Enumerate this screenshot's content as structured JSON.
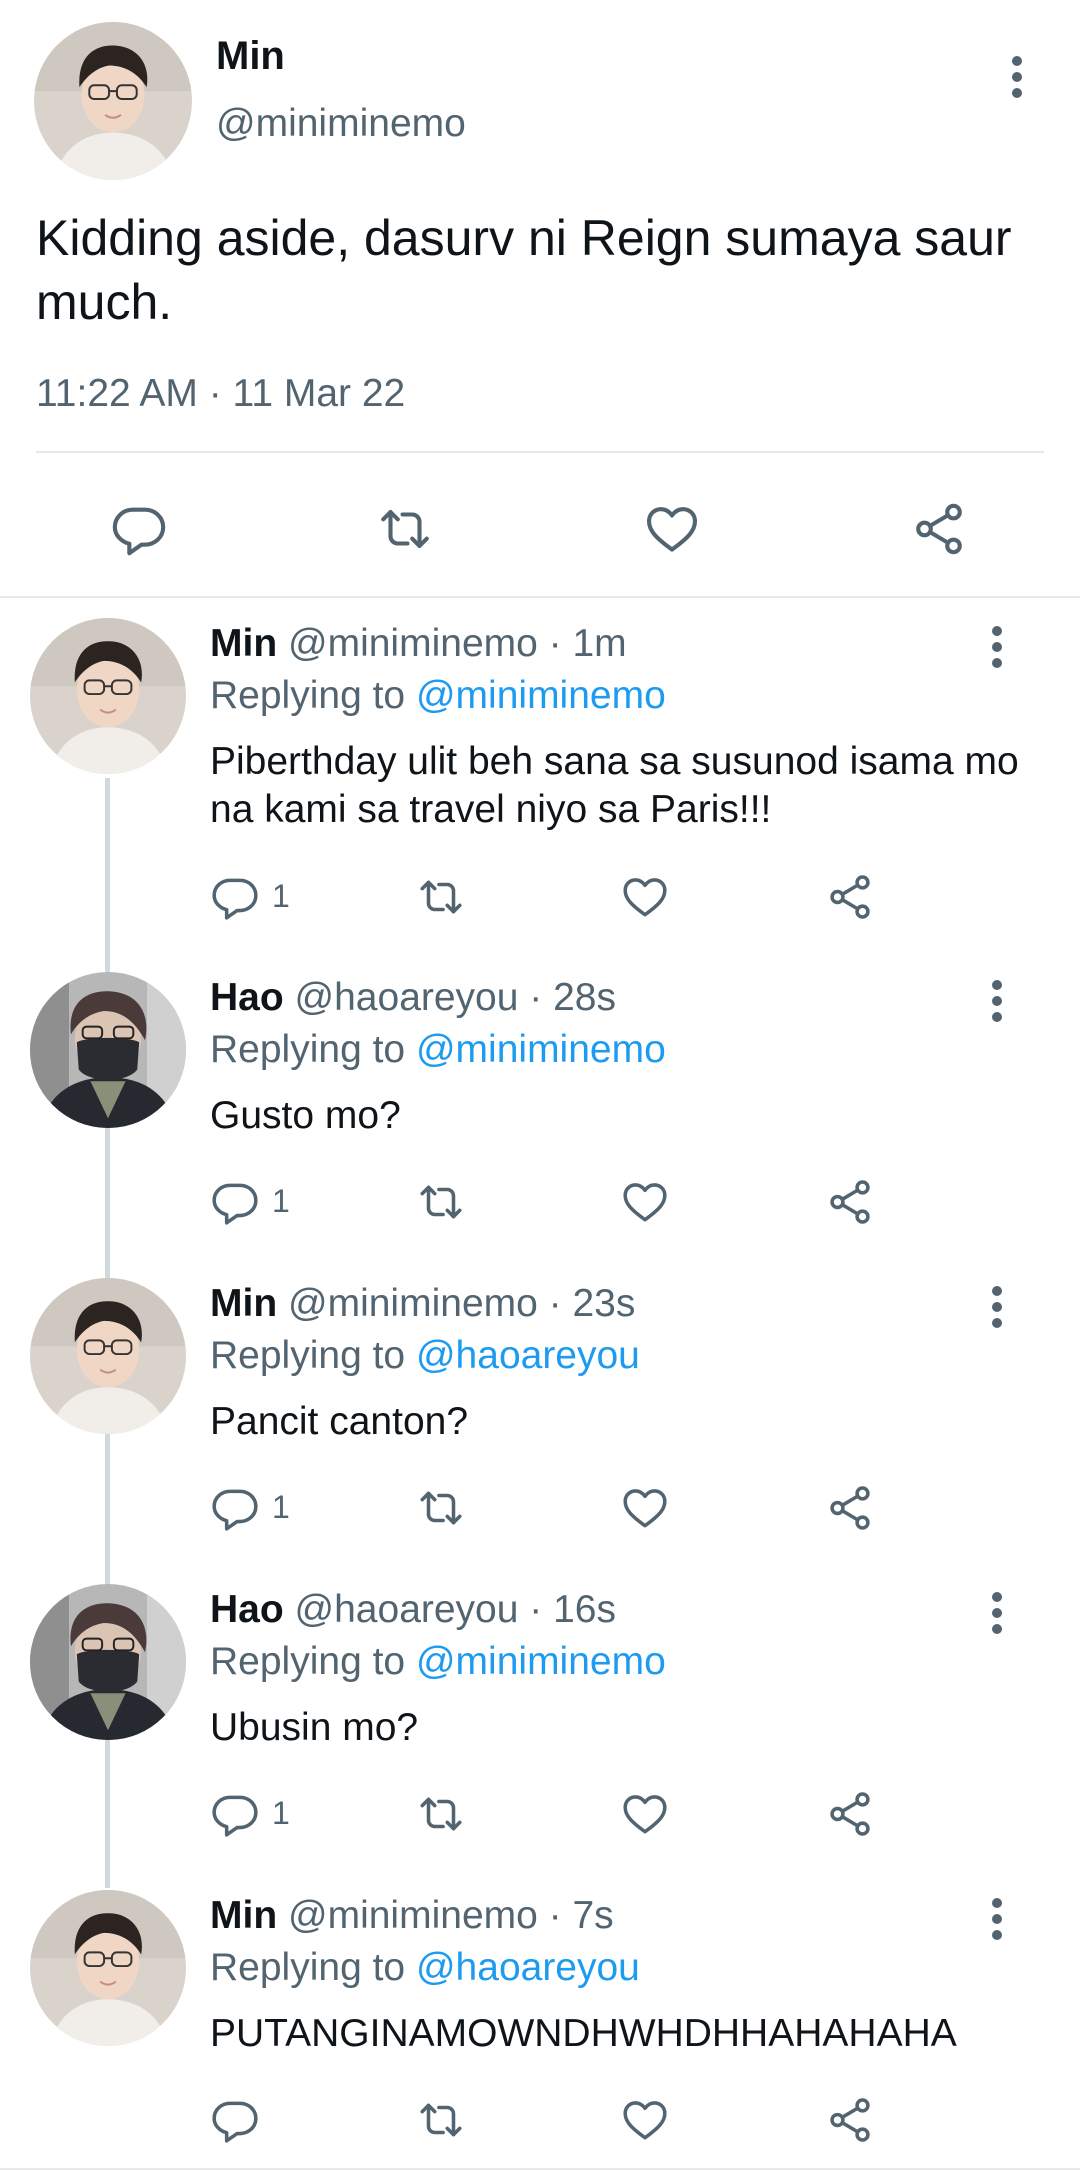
{
  "main_tweet": {
    "name": "Min",
    "handle": "@miniminemo",
    "text": "Kidding aside, dasurv ni Reign sumaya saur much.",
    "timestamp": "11:22 AM · 11 Mar 22"
  },
  "replies": [
    {
      "name": "Min",
      "meta": "@miniminemo · 1m",
      "replying_prefix": "Replying to",
      "replying_to": "@miniminemo",
      "text": "Piberthday ulit beh sana sa susunod isama mo na kami sa travel niyo sa Paris!!!",
      "reply_count": "1"
    },
    {
      "name": "Hao",
      "meta": "@haoareyou · 28s",
      "replying_prefix": "Replying to",
      "replying_to": "@miniminemo",
      "text": "Gusto mo?",
      "reply_count": "1"
    },
    {
      "name": "Min",
      "meta": "@miniminemo · 23s",
      "replying_prefix": "Replying to",
      "replying_to": "@haoareyou",
      "text": "Pancit canton?",
      "reply_count": "1"
    },
    {
      "name": "Hao",
      "meta": "@haoareyou · 16s",
      "replying_prefix": "Replying to",
      "replying_to": "@miniminemo",
      "text": "Ubusin mo?",
      "reply_count": "1"
    },
    {
      "name": "Min",
      "meta": "@miniminemo · 7s",
      "replying_prefix": "Replying to",
      "replying_to": "@haoareyou",
      "text": "PUTANGINAMOWNDHWHDHHAHAHAHA",
      "reply_count": ""
    }
  ],
  "colors": {
    "accent": "#1d9bf0",
    "secondary_text": "#536471",
    "text": "#0f1419"
  }
}
